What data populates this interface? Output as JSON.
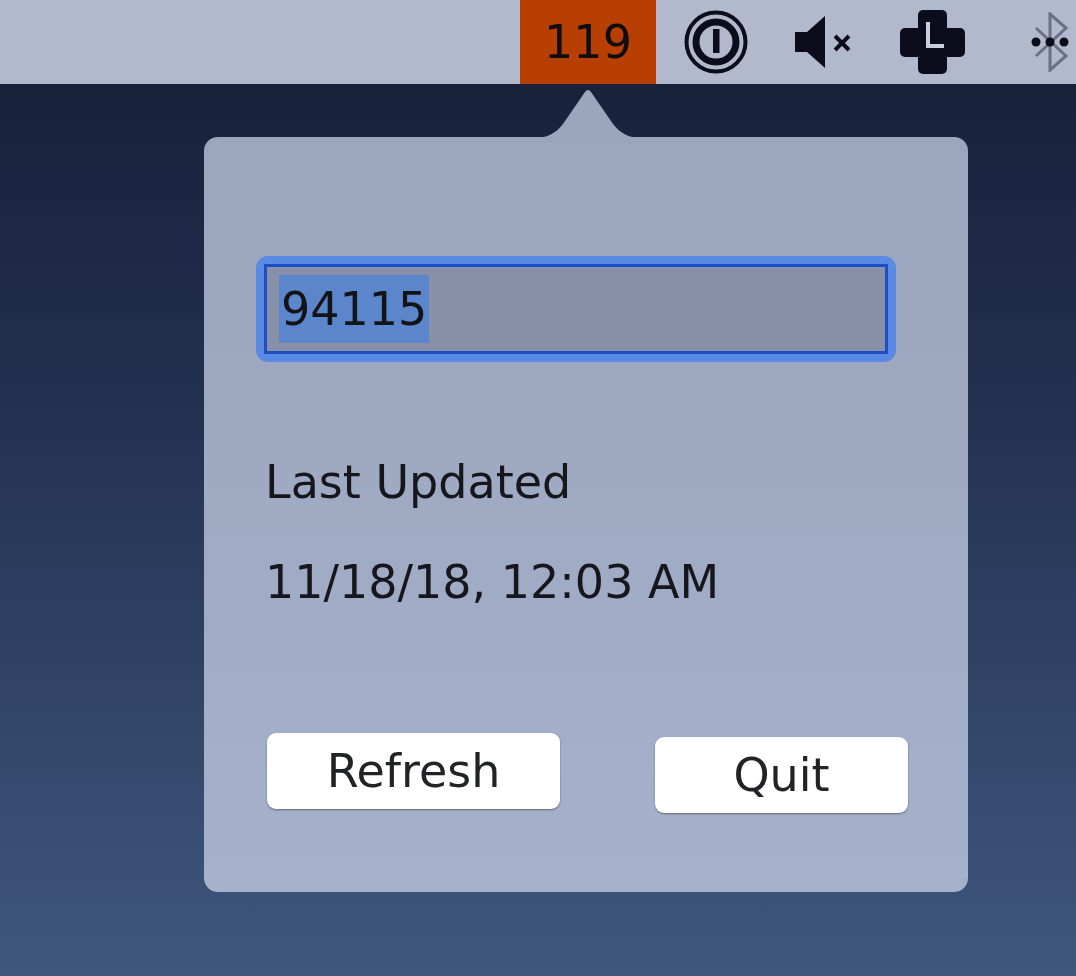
{
  "menu_bar": {
    "status_item": {
      "text": "119"
    }
  },
  "popover": {
    "zip_field": {
      "value": "94115",
      "focused": true,
      "value_selected": true
    },
    "last_updated_label": "Last Updated",
    "last_updated_value": "11/18/18, 12:03 AM",
    "buttons": [
      {
        "label": "Refresh"
      },
      {
        "label": "Quit"
      }
    ]
  }
}
